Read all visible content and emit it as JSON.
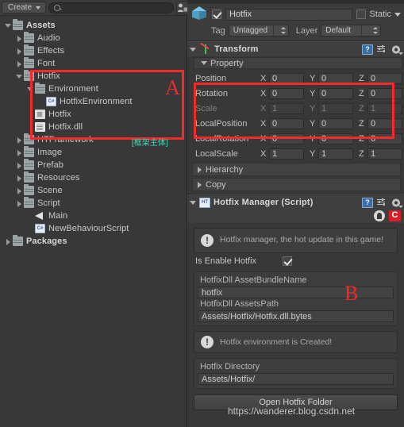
{
  "project": {
    "toolbar": {
      "create_label": "Create",
      "search_value": "",
      "search_placeholder": "",
      "filter_type_icon": "object-filter-icon",
      "filter_label_icon": "label-filter-icon"
    },
    "tree": [
      {
        "label": "Assets",
        "icon": "folder",
        "depth": 0,
        "twist": "open",
        "bold": true
      },
      {
        "label": "Audio",
        "icon": "folder",
        "depth": 1,
        "twist": "closed",
        "bold": false
      },
      {
        "label": "Effects",
        "icon": "folder",
        "depth": 1,
        "twist": "closed",
        "bold": false
      },
      {
        "label": "Font",
        "icon": "folder",
        "depth": 1,
        "twist": "closed",
        "bold": false
      },
      {
        "label": "Hotfix",
        "icon": "folder",
        "depth": 1,
        "twist": "open",
        "bold": false
      },
      {
        "label": "Environment",
        "icon": "folder",
        "depth": 2,
        "twist": "open",
        "bold": false
      },
      {
        "label": "HotfixEnvironment",
        "icon": "cs",
        "depth": 3,
        "twist": "none",
        "bold": false
      },
      {
        "label": "Hotfix",
        "icon": "asmfile",
        "depth": 2,
        "twist": "none",
        "bold": false
      },
      {
        "label": "Hotfix.dll",
        "icon": "file",
        "depth": 2,
        "twist": "none",
        "bold": false
      },
      {
        "label": "HTFramework",
        "icon": "folder",
        "depth": 1,
        "twist": "closed",
        "bold": false
      },
      {
        "label": "Image",
        "icon": "folder",
        "depth": 1,
        "twist": "closed",
        "bold": false
      },
      {
        "label": "Prefab",
        "icon": "folder",
        "depth": 1,
        "twist": "closed",
        "bold": false
      },
      {
        "label": "Resources",
        "icon": "folder",
        "depth": 1,
        "twist": "closed",
        "bold": false
      },
      {
        "label": "Scene",
        "icon": "folder",
        "depth": 1,
        "twist": "closed",
        "bold": false
      },
      {
        "label": "Script",
        "icon": "folder",
        "depth": 1,
        "twist": "closed",
        "bold": false
      },
      {
        "label": "Main",
        "icon": "prefab",
        "depth": 2,
        "twist": "none",
        "bold": false
      },
      {
        "label": "NewBehaviourScript",
        "icon": "cs",
        "depth": 2,
        "twist": "none",
        "bold": false
      },
      {
        "label": "Packages",
        "icon": "folder",
        "depth": 0,
        "twist": "closed",
        "bold": true
      }
    ]
  },
  "annotations": {
    "letter_a": "A",
    "letter_b": "B",
    "green_note": "[框架主体]",
    "box_color": "#f42a2a",
    "green_color": "#39e2c4"
  },
  "inspector": {
    "gameobject": {
      "active": true,
      "name": "Hotfix",
      "static_label": "Static",
      "static_checked": false,
      "tag_label": "Tag",
      "tag_value": "Untagged",
      "layer_label": "Layer",
      "layer_value": "Default",
      "cube_icon": "gameobject-cube-icon"
    },
    "transform": {
      "title": "Transform",
      "icon": "transform-axis-icon",
      "help_icon": "help-book-icon",
      "preset_icon": "preset-sliders-icon",
      "menu_icon": "gear-icon",
      "property_foldout": "Property",
      "rows": [
        {
          "label": "Position",
          "x": "0",
          "y": "0",
          "z": "0",
          "dim": false
        },
        {
          "label": "Rotation",
          "x": "0",
          "y": "0",
          "z": "0",
          "dim": false
        },
        {
          "label": "Scale",
          "x": "1",
          "y": "1",
          "z": "1",
          "dim": true
        },
        {
          "label": "LocalPosition",
          "x": "0",
          "y": "0",
          "z": "0",
          "dim": false
        },
        {
          "label": "LocalRotation",
          "x": "0",
          "y": "0",
          "z": "0",
          "dim": false
        },
        {
          "label": "LocalScale",
          "x": "1",
          "y": "1",
          "z": "1",
          "dim": false
        }
      ],
      "axis_x": "X",
      "axis_y": "Y",
      "axis_z": "Z",
      "hierarchy_foldout": "Hierarchy",
      "copy_foldout": "Copy"
    },
    "hotfix_manager": {
      "title": "Hotfix Manager (Script)",
      "script_icon": "ht-script-icon",
      "help_icon": "help-book-icon",
      "preset_icon": "preset-sliders-icon",
      "menu_icon": "gear-icon",
      "github_icon": "github-icon",
      "csdn_icon": "csdn-c-icon",
      "info_icon": "info-exclamation-icon",
      "info_text": "Hotfix manager, the hot update in this game!",
      "enable_label": "Is Enable Hotfix",
      "enable_checked": true,
      "assetbundle_label": "HotfixDll AssetBundleName",
      "assetbundle_value": "hotfix",
      "assetspath_label": "HotfixDll AssetsPath",
      "assetspath_value": "Assets/Hotfix/Hotfix.dll.bytes",
      "created_text": "Hotfix environment is Created!",
      "directory_label": "Hotfix Directory",
      "directory_value": "Assets/Hotfix/",
      "action_button_label": "Open Hotfix Folder"
    }
  },
  "watermark": {
    "text": "https://wanderer.blog.csdn.net"
  }
}
